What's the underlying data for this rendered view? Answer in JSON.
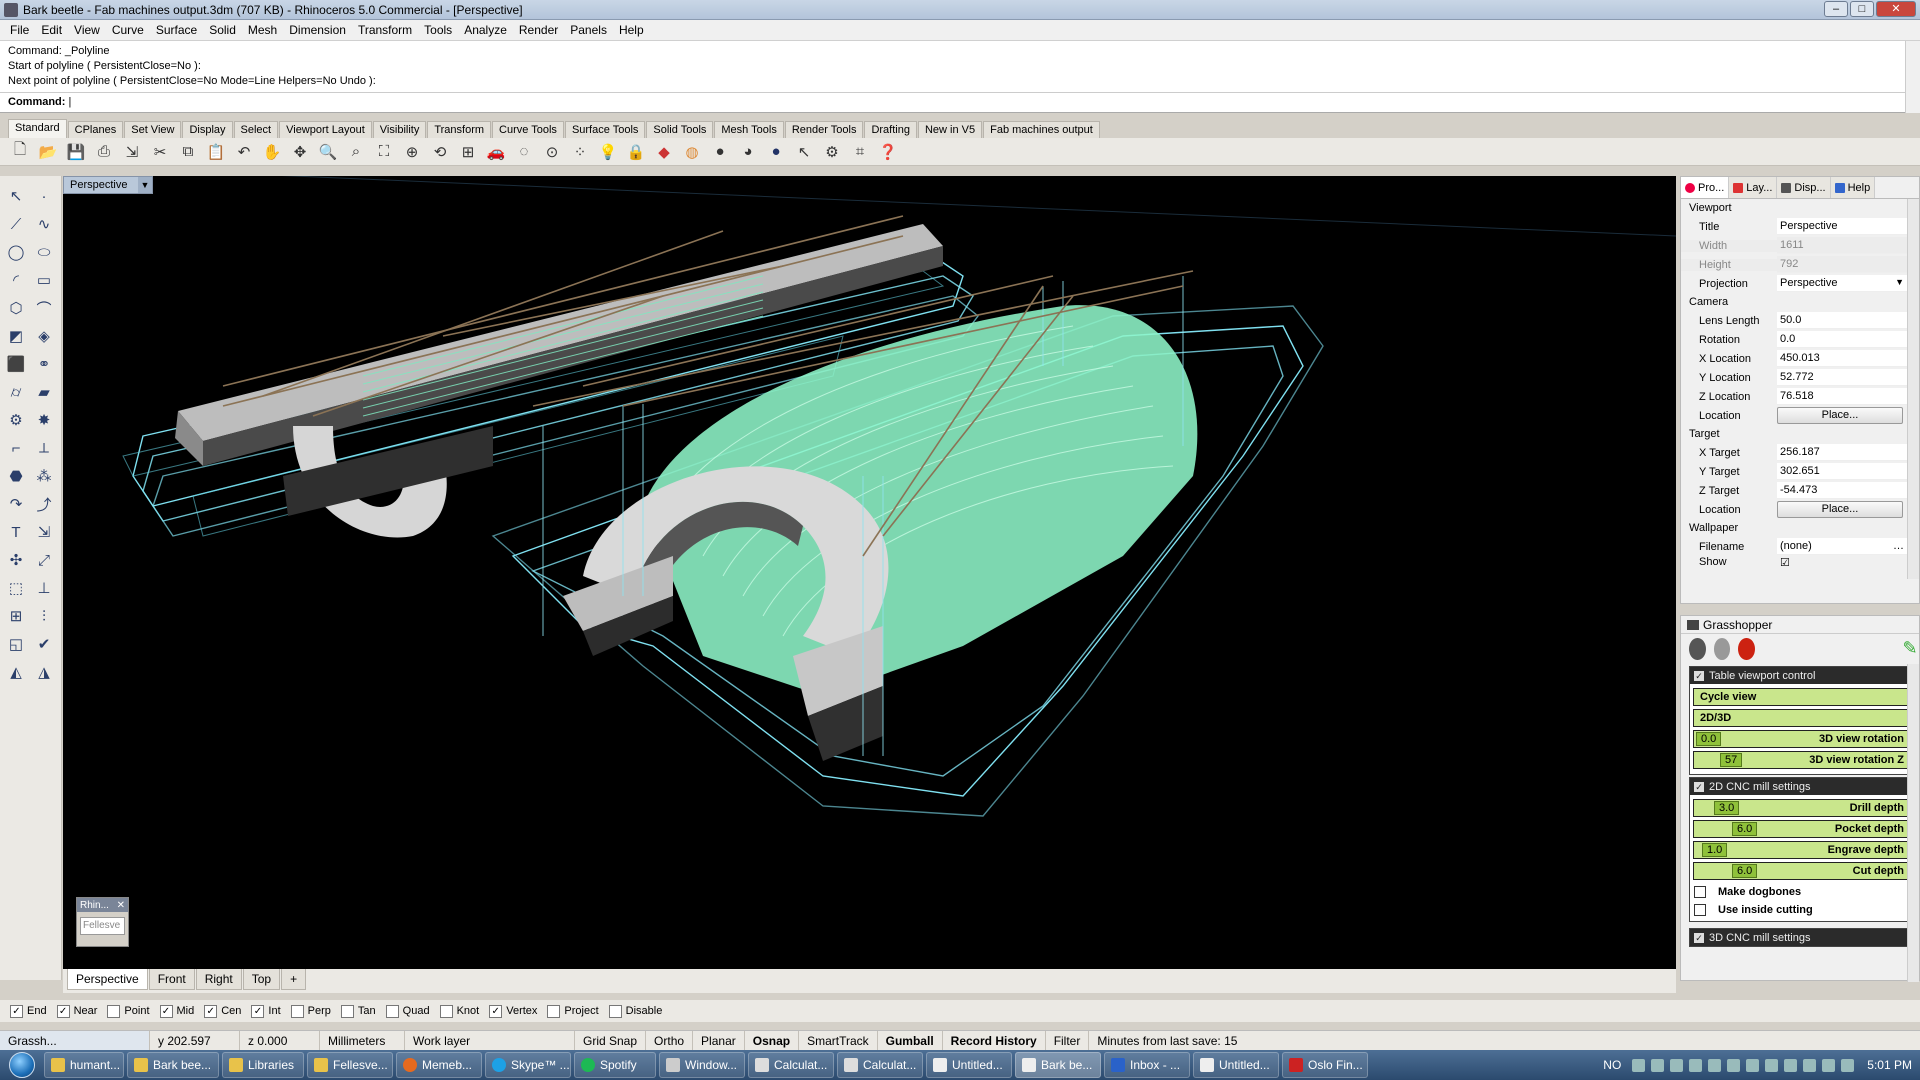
{
  "window": {
    "title": "Bark beetle - Fab machines output.3dm (707 KB) - Rhinoceros 5.0 Commercial - [Perspective]"
  },
  "menu": [
    "File",
    "Edit",
    "View",
    "Curve",
    "Surface",
    "Solid",
    "Mesh",
    "Dimension",
    "Transform",
    "Tools",
    "Analyze",
    "Render",
    "Panels",
    "Help"
  ],
  "command": {
    "history": [
      "Command: _Polyline",
      "Start of polyline ( PersistentClose=No ):",
      "Next point of polyline ( PersistentClose=No  Mode=Line  Helpers=No  Undo ):"
    ],
    "prompt": "Command:"
  },
  "toolbar_tabs": [
    "Standard",
    "CPlanes",
    "Set View",
    "Display",
    "Select",
    "Viewport Layout",
    "Visibility",
    "Transform",
    "Curve Tools",
    "Surface Tools",
    "Solid Tools",
    "Mesh Tools",
    "Render Tools",
    "Drafting",
    "New in V5",
    "Fab machines output"
  ],
  "toolbar_icons": [
    "new-icon",
    "open-icon",
    "save-icon",
    "print-icon",
    "import-icon",
    "cut-icon",
    "copy-icon",
    "paste-icon",
    "undo-icon",
    "pan-icon",
    "move-view-icon",
    "zoom-icon",
    "zoom-window-icon",
    "zoom-extents-icon",
    "zoom-selected-icon",
    "rotate-view-icon",
    "four-viewports-icon",
    "car-icon",
    "hide-icon",
    "show-icon",
    "select-points-icon",
    "light-icon",
    "lock-icon",
    "layer-icon",
    "color-wheel-icon",
    "sphere-icon",
    "render-icon",
    "material-icon",
    "pointer-icon",
    "options-icon",
    "grid-icon",
    "help-icon"
  ],
  "viewport": {
    "title": "Perspective",
    "mini_title": "Rhin...",
    "mini_field": "Fellesve"
  },
  "viewport_tabs": [
    "Perspective",
    "Front",
    "Right",
    "Top",
    "+"
  ],
  "osnap": [
    {
      "label": "End",
      "checked": true
    },
    {
      "label": "Near",
      "checked": true
    },
    {
      "label": "Point",
      "checked": false
    },
    {
      "label": "Mid",
      "checked": true
    },
    {
      "label": "Cen",
      "checked": true
    },
    {
      "label": "Int",
      "checked": true
    },
    {
      "label": "Perp",
      "checked": false
    },
    {
      "label": "Tan",
      "checked": false
    },
    {
      "label": "Quad",
      "checked": false
    },
    {
      "label": "Knot",
      "checked": false
    },
    {
      "label": "Vertex",
      "checked": true
    },
    {
      "label": "Project",
      "checked": false
    },
    {
      "label": "Disable",
      "checked": false
    }
  ],
  "status": {
    "grasshopper": "Grassh...",
    "y": "y 202.597",
    "z": "z 0.000",
    "units": "Millimeters",
    "layer": "Work layer",
    "grid_snap": "Grid Snap",
    "ortho": "Ortho",
    "planar": "Planar",
    "osnap": "Osnap",
    "smarttrack": "SmartTrack",
    "gumball": "Gumball",
    "record_history": "Record History",
    "filter": "Filter",
    "save_info": "Minutes from last save: 15"
  },
  "properties": {
    "tabs": [
      "Pro...",
      "Lay...",
      "Disp...",
      "Help"
    ],
    "sections": {
      "viewport": "Viewport",
      "camera": "Camera",
      "target": "Target",
      "wallpaper": "Wallpaper"
    },
    "title": {
      "label": "Title",
      "value": "Perspective"
    },
    "width": {
      "label": "Width",
      "value": "1611"
    },
    "height": {
      "label": "Height",
      "value": "792"
    },
    "projection": {
      "label": "Projection",
      "value": "Perspective"
    },
    "lens_length": {
      "label": "Lens Length",
      "value": "50.0"
    },
    "rotation": {
      "label": "Rotation",
      "value": "0.0"
    },
    "x_location": {
      "label": "X Location",
      "value": "450.013"
    },
    "y_location": {
      "label": "Y Location",
      "value": "52.772"
    },
    "z_location": {
      "label": "Z Location",
      "value": "76.518"
    },
    "cam_location": {
      "label": "Location",
      "button": "Place..."
    },
    "x_target": {
      "label": "X Target",
      "value": "256.187"
    },
    "y_target": {
      "label": "Y Target",
      "value": "302.651"
    },
    "z_target": {
      "label": "Z Target",
      "value": "-54.473"
    },
    "tgt_location": {
      "label": "Location",
      "button": "Place..."
    },
    "filename": {
      "label": "Filename",
      "value": "(none)"
    },
    "show": {
      "label": "Show"
    }
  },
  "grasshopper": {
    "title": "Grasshopper",
    "group1": {
      "title": "Table viewport control",
      "buttons": [
        "Cycle view",
        "2D/3D"
      ],
      "sliders": [
        {
          "value": "0.0",
          "label": "3D view rotation",
          "fill": 0.0
        },
        {
          "value": "57",
          "label": "3D view rotation Z",
          "fill": 0.16
        }
      ]
    },
    "group2": {
      "title": "2D CNC mill settings",
      "sliders": [
        {
          "value": "3.0",
          "label": "Drill depth",
          "fill": 0.12
        },
        {
          "value": "6.0",
          "label": "Pocket depth",
          "fill": 0.24
        },
        {
          "value": "1.0",
          "label": "Engrave depth",
          "fill": 0.04
        },
        {
          "value": "6.0",
          "label": "Cut depth",
          "fill": 0.24
        }
      ],
      "checkboxes": [
        "Make dogbones",
        "Use inside cutting"
      ]
    },
    "group3": {
      "title": "3D CNC mill settings"
    }
  },
  "taskbar": {
    "tasks": [
      "humant...",
      "Bark bee...",
      "Libraries",
      "Fellesve...",
      "Memeb...",
      "Skype™ ...",
      "Spotify",
      "Window...",
      "Calculat...",
      "Calculat...",
      "Untitled...",
      "Bark be...",
      "Inbox - ...",
      "Untitled...",
      "Oslo Fin..."
    ],
    "lang": "NO",
    "clock": "5:01 PM"
  }
}
